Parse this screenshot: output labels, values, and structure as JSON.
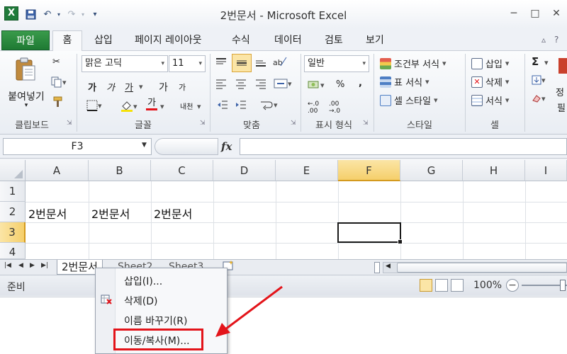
{
  "window": {
    "title": "2번문서  -  Microsoft Excel",
    "app_icon_letter": "X",
    "qat_icons": [
      "save-icon",
      "undo-icon",
      "redo-icon",
      "customize-qat-icon"
    ],
    "controls": {
      "minimize": "─",
      "maximize": "□",
      "close": "✕"
    }
  },
  "ribbon": {
    "file_tab": "파일",
    "tabs": [
      "홈",
      "삽입",
      "페이지 레이아웃",
      "수식",
      "데이터",
      "검토",
      "보기"
    ],
    "active_tab": "홈",
    "clipboard": {
      "label": "클립보드",
      "paste_line1": "붙여넣기",
      "paste_line2": "▾"
    },
    "font": {
      "label": "글꼴",
      "font_name": "맑은 고딕",
      "font_size": "11",
      "bold": "가",
      "italic": "가",
      "underline": "가",
      "grow": "가",
      "shrink": "가",
      "font_color_glyph": "가",
      "phonetic": "내천"
    },
    "alignment": {
      "label": "맞춤"
    },
    "number": {
      "label": "표시 형식",
      "format": "일반",
      "percent": "%",
      "comma": ","
    },
    "styles": {
      "label": "스타일",
      "conditional": "조건부 서식",
      "table": "표 서식",
      "cell_style": "셀 스타일"
    },
    "cells": {
      "label": "셀",
      "insert": "삽입",
      "delete": "삭제",
      "format": "서식"
    },
    "editing": {
      "sigma": "Σ",
      "sort_partial": "정",
      "find_partial": "필"
    }
  },
  "formula_bar": {
    "name_box": "F3",
    "fx": "fx",
    "value": ""
  },
  "grid": {
    "columns": [
      "A",
      "B",
      "C",
      "D",
      "E",
      "F",
      "G",
      "H",
      "I"
    ],
    "rows": [
      "1",
      "2",
      "3",
      "4"
    ],
    "selected_cell": "F3",
    "cells": {
      "A2": "2번문서",
      "B2": "2번문서",
      "C2": "2번문서"
    }
  },
  "sheets": {
    "tabs": [
      "2번문서",
      "Sheet2",
      "Sheet3"
    ],
    "active": "2번문서"
  },
  "status": {
    "text": "준비",
    "zoom": "100%"
  },
  "context_menu": {
    "items": [
      "삽입(I)...",
      "삭제(D)",
      "이름 바꾸기(R)",
      "이동/복사(M)..."
    ],
    "highlighted": "이동/복사(M)..."
  },
  "colors": {
    "file_tab": "#1e7a33",
    "selection_header": "#f5cf6b",
    "annotation_red": "#e3141a"
  }
}
